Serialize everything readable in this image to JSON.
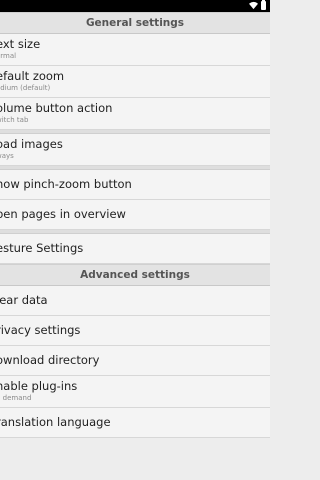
{
  "general_header": "General settings",
  "advanced_header": "Advanced settings",
  "general_items": [
    {
      "title": "ext size",
      "summary": "ormal"
    },
    {
      "title": "efault zoom",
      "summary": "edium (default)"
    },
    {
      "title": "olume button action",
      "summary": "witch tab"
    }
  ],
  "load_images": {
    "title": "oad images",
    "summary": "ways"
  },
  "pinch_zoom": {
    "title": "how pinch-zoom button"
  },
  "overview": {
    "title": "pen pages in overview"
  },
  "gesture": {
    "title": "esture Settings"
  },
  "advanced_items": [
    {
      "title": "lear data"
    },
    {
      "title": "rivacy settings"
    },
    {
      "title": "ownload directory"
    }
  ],
  "plugins": {
    "title": "nable plug-ins",
    "summary": "n demand"
  },
  "translation": {
    "title": "ranslation language"
  }
}
